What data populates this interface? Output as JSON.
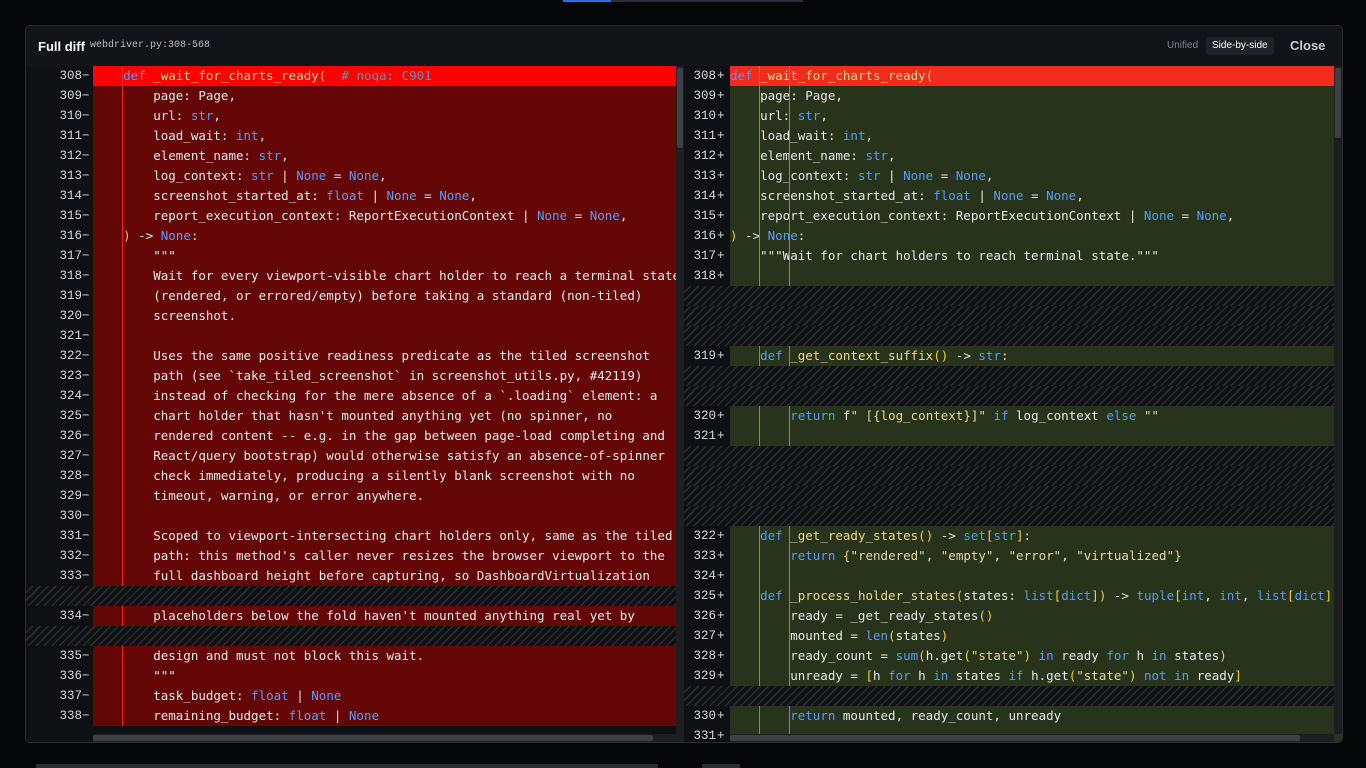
{
  "header": {
    "title": "Full diff",
    "file_range": "webdriver.py:308-568",
    "unified_label": "Unified",
    "side_by_side_label": "Side-by-side",
    "close_label": "Close"
  },
  "left_rows": [
    {
      "num": "308",
      "sign": "−",
      "type": "hl",
      "text": "    def _wait_for_charts_ready(  # noqa: C901"
    },
    {
      "num": "309",
      "sign": "−",
      "type": "del",
      "text": "        page: Page,"
    },
    {
      "num": "310",
      "sign": "−",
      "type": "del",
      "text": "        url: str,"
    },
    {
      "num": "311",
      "sign": "−",
      "type": "del",
      "text": "        load_wait: int,"
    },
    {
      "num": "312",
      "sign": "−",
      "type": "del",
      "text": "        element_name: str,"
    },
    {
      "num": "313",
      "sign": "−",
      "type": "del",
      "text": "        log_context: str | None = None,"
    },
    {
      "num": "314",
      "sign": "−",
      "type": "del",
      "text": "        screenshot_started_at: float | None = None,"
    },
    {
      "num": "315",
      "sign": "−",
      "type": "del",
      "text": "        report_execution_context: ReportExecutionContext | None = None,"
    },
    {
      "num": "316",
      "sign": "−",
      "type": "del",
      "text": "    ) -> None:"
    },
    {
      "num": "317",
      "sign": "−",
      "type": "del",
      "text": "        \"\"\""
    },
    {
      "num": "318",
      "sign": "−",
      "type": "del",
      "text": "        Wait for every viewport-visible chart holder to reach a terminal state"
    },
    {
      "num": "319",
      "sign": "−",
      "type": "del",
      "text": "        (rendered, or errored/empty) before taking a standard (non-tiled)"
    },
    {
      "num": "320",
      "sign": "−",
      "type": "del",
      "text": "        screenshot."
    },
    {
      "num": "321",
      "sign": "−",
      "type": "del",
      "text": ""
    },
    {
      "num": "322",
      "sign": "−",
      "type": "del",
      "text": "        Uses the same positive readiness predicate as the tiled screenshot"
    },
    {
      "num": "323",
      "sign": "−",
      "type": "del",
      "text": "        path (see `take_tiled_screenshot` in screenshot_utils.py, #42119)"
    },
    {
      "num": "324",
      "sign": "−",
      "type": "del",
      "text": "        instead of checking for the mere absence of a `.loading` element: a"
    },
    {
      "num": "325",
      "sign": "−",
      "type": "del",
      "text": "        chart holder that hasn't mounted anything yet (no spinner, no"
    },
    {
      "num": "326",
      "sign": "−",
      "type": "del",
      "text": "        rendered content -- e.g. in the gap between page-load completing and"
    },
    {
      "num": "327",
      "sign": "−",
      "type": "del",
      "text": "        React/query bootstrap) would otherwise satisfy an absence-of-spinner"
    },
    {
      "num": "328",
      "sign": "−",
      "type": "del",
      "text": "        check immediately, producing a silently blank screenshot with no"
    },
    {
      "num": "329",
      "sign": "−",
      "type": "del",
      "text": "        timeout, warning, or error anywhere."
    },
    {
      "num": "330",
      "sign": "−",
      "type": "del",
      "text": ""
    },
    {
      "num": "331",
      "sign": "−",
      "type": "del",
      "text": "        Scoped to viewport-intersecting chart holders only, same as the tiled"
    },
    {
      "num": "332",
      "sign": "−",
      "type": "del",
      "text": "        path: this method's caller never resizes the browser viewport to the"
    },
    {
      "num": "333",
      "sign": "−",
      "type": "del",
      "text": "        full dashboard height before capturing, so DashboardVirtualization"
    },
    {
      "num": "",
      "sign": "",
      "type": "filler",
      "text": ""
    },
    {
      "num": "334",
      "sign": "−",
      "type": "del",
      "text": "        placeholders below the fold haven't mounted anything real yet by"
    },
    {
      "num": "",
      "sign": "",
      "type": "filler",
      "text": ""
    },
    {
      "num": "335",
      "sign": "−",
      "type": "del",
      "text": "        design and must not block this wait."
    },
    {
      "num": "336",
      "sign": "−",
      "type": "del",
      "text": "        \"\"\""
    },
    {
      "num": "337",
      "sign": "−",
      "type": "del",
      "text": "        task_budget: float | None"
    },
    {
      "num": "338",
      "sign": "−",
      "type": "del",
      "text": "        remaining_budget: float | None"
    }
  ],
  "right_rows": [
    {
      "num": "308",
      "sign": "+",
      "type": "hl",
      "text": "def _wait_for_charts_ready("
    },
    {
      "num": "309",
      "sign": "+",
      "type": "add",
      "text": "    page: Page,"
    },
    {
      "num": "310",
      "sign": "+",
      "type": "add",
      "text": "    url: str,"
    },
    {
      "num": "311",
      "sign": "+",
      "type": "add",
      "text": "    load_wait: int,"
    },
    {
      "num": "312",
      "sign": "+",
      "type": "add",
      "text": "    element_name: str,"
    },
    {
      "num": "313",
      "sign": "+",
      "type": "add",
      "text": "    log_context: str | None = None,"
    },
    {
      "num": "314",
      "sign": "+",
      "type": "add",
      "text": "    screenshot_started_at: float | None = None,"
    },
    {
      "num": "315",
      "sign": "+",
      "type": "add",
      "text": "    report_execution_context: ReportExecutionContext | None = None,"
    },
    {
      "num": "316",
      "sign": "+",
      "type": "add",
      "text": ") -> None:"
    },
    {
      "num": "317",
      "sign": "+",
      "type": "add",
      "text": "    \"\"\"Wait for chart holders to reach terminal state.\"\"\""
    },
    {
      "num": "318",
      "sign": "+",
      "type": "add",
      "text": ""
    },
    {
      "num": "",
      "sign": "",
      "type": "filler",
      "text": ""
    },
    {
      "num": "",
      "sign": "",
      "type": "filler",
      "text": ""
    },
    {
      "num": "",
      "sign": "",
      "type": "filler",
      "text": ""
    },
    {
      "num": "319",
      "sign": "+",
      "type": "add",
      "text": "    def _get_context_suffix() -> str:"
    },
    {
      "num": "",
      "sign": "",
      "type": "filler",
      "text": ""
    },
    {
      "num": "",
      "sign": "",
      "type": "filler",
      "text": ""
    },
    {
      "num": "320",
      "sign": "+",
      "type": "add",
      "text": "        return f\" [{log_context}]\" if log_context else \"\""
    },
    {
      "num": "321",
      "sign": "+",
      "type": "add",
      "text": ""
    },
    {
      "num": "",
      "sign": "",
      "type": "filler",
      "text": ""
    },
    {
      "num": "",
      "sign": "",
      "type": "filler",
      "text": ""
    },
    {
      "num": "",
      "sign": "",
      "type": "filler",
      "text": ""
    },
    {
      "num": "",
      "sign": "",
      "type": "filler",
      "text": ""
    },
    {
      "num": "322",
      "sign": "+",
      "type": "add",
      "text": "    def _get_ready_states() -> set[str]:"
    },
    {
      "num": "323",
      "sign": "+",
      "type": "add",
      "text": "        return {\"rendered\", \"empty\", \"error\", \"virtualized\"}"
    },
    {
      "num": "324",
      "sign": "+",
      "type": "add",
      "text": ""
    },
    {
      "num": "325",
      "sign": "+",
      "type": "add",
      "text": "    def _process_holder_states(states: list[dict]) -> tuple[int, int, list[dict]]:"
    },
    {
      "num": "326",
      "sign": "+",
      "type": "add",
      "text": "        ready = _get_ready_states()"
    },
    {
      "num": "327",
      "sign": "+",
      "type": "add",
      "text": "        mounted = len(states)"
    },
    {
      "num": "328",
      "sign": "+",
      "type": "add",
      "text": "        ready_count = sum(h.get(\"state\") in ready for h in states)"
    },
    {
      "num": "329",
      "sign": "+",
      "type": "add",
      "text": "        unready = [h for h in states if h.get(\"state\") not in ready]"
    },
    {
      "num": "",
      "sign": "",
      "type": "filler",
      "text": ""
    },
    {
      "num": "330",
      "sign": "+",
      "type": "add",
      "text": "        return mounted, ready_count, unready"
    },
    {
      "num": "331",
      "sign": "+",
      "type": "add",
      "text": ""
    }
  ]
}
